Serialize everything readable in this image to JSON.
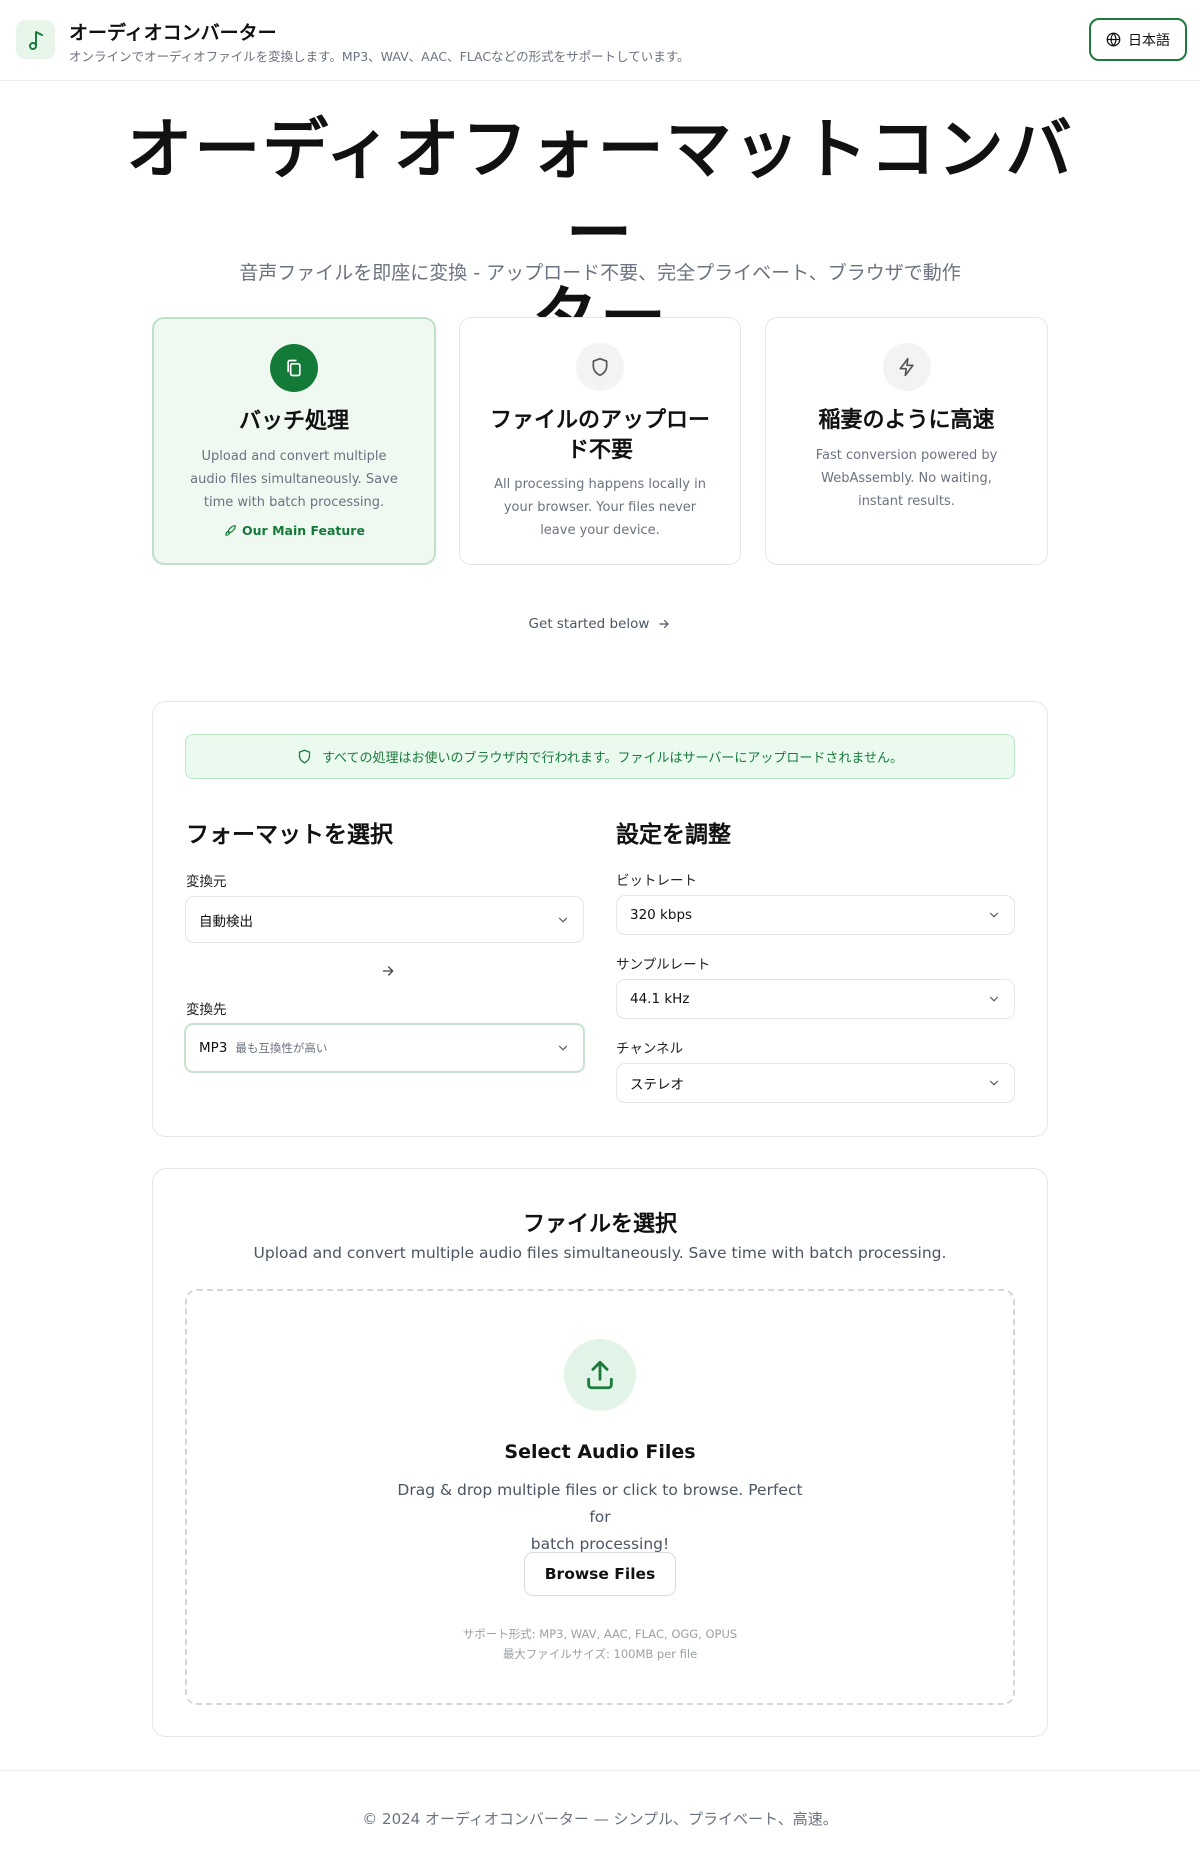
{
  "header": {
    "app_title": "オーディオコンバーター",
    "app_subtitle": "オンラインでオーディオファイルを変換します。MP3、WAV、AAC、FLACなどの形式をサポートしています。",
    "language": "日本語",
    "logo_icon": "music-note-icon",
    "language_icon": "globe-icon"
  },
  "hero": {
    "title_line1": "オーディオフォーマットコンバー",
    "title_line2": "ター",
    "subtitle": "音声ファイルを即座に変換 - アップロード不要、完全プライベート、ブラウザで動作"
  },
  "features": [
    {
      "icon": "copy-files-icon",
      "title": "バッチ処理",
      "description": "Upload and convert multiple audio files simultaneously. Save time with batch processing.",
      "tag": "Our Main Feature",
      "tag_icon": "rocket-icon"
    },
    {
      "icon": "shield-icon",
      "title": "ファイルのアップロード不要",
      "description": "All processing happens locally in your browser. Your files never leave your device."
    },
    {
      "icon": "lightning-icon",
      "title": "稲妻のように高速",
      "description": "Fast conversion powered by WebAssembly. No waiting, instant results."
    }
  ],
  "get_started": "Get started below",
  "converter": {
    "privacy_notice": "すべての処理はお使いのブラウザ内で行われます。ファイルはサーバーにアップロードされません。",
    "format_title": "フォーマットを選択",
    "from_label": "変換元",
    "from_value": "自動検出",
    "to_label": "変換先",
    "to_value": "MP3",
    "to_note": "最も互換性が高い",
    "settings_title": "設定を調整",
    "bitrate_label": "ビットレート",
    "bitrate_value": "320 kbps",
    "samplerate_label": "サンプルレート",
    "samplerate_value": "44.1 kHz",
    "channel_label": "チャンネル",
    "channel_value": "ステレオ"
  },
  "upload": {
    "title": "ファイルを選択",
    "subtitle": "Upload and convert multiple audio files simultaneously. Save time with batch processing.",
    "dropzone_title": "Select Audio Files",
    "dropzone_desc_line1": "Drag & drop multiple files or click to browse. Perfect for",
    "dropzone_desc_line2": "batch processing!",
    "browse_button": "Browse Files",
    "formats_note": "サポート形式: MP3, WAV, AAC, FLAC, OGG, OPUS",
    "max_size_note": "最大ファイルサイズ: 100MB per file"
  },
  "footer": {
    "text": "© 2024 オーディオコンバーター — シンプル、プライベート、高速。"
  },
  "colors": {
    "accent": "#147a38",
    "accent_light": "#e7f5ea",
    "notice_bg": "#eafaef",
    "text_muted": "#6b7280"
  }
}
